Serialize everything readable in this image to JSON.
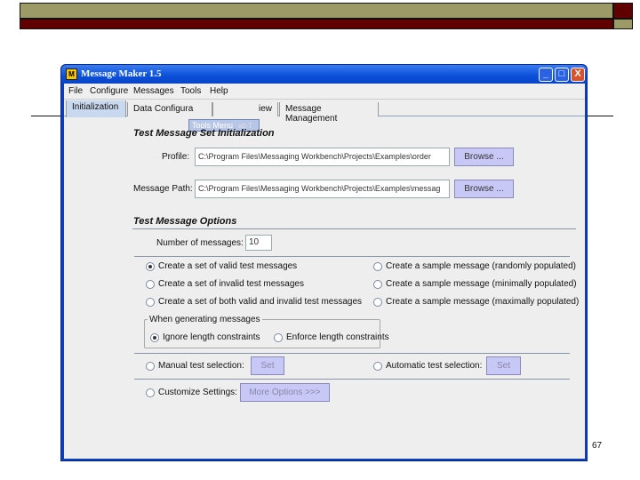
{
  "slide": {
    "page_number": "67",
    "colors": {
      "olive": "#9c9a66",
      "maroon": "#600000"
    }
  },
  "window": {
    "title": "Message Maker 1.5",
    "icon": "app-icon",
    "icon_text": "M",
    "controls": {
      "minimize": "_",
      "maximize": "□",
      "close": "X"
    }
  },
  "menu": [
    "File",
    "Configure",
    "Messages",
    "Tools",
    "Help"
  ],
  "tabs": [
    "Initialization",
    "Data Configura",
    "iew",
    "Message Management"
  ],
  "tooltip": {
    "text": "Tools Menu",
    "accelerator": "alt-T"
  },
  "init": {
    "title": "Test Message Set Initialization",
    "profile_label": "Profile:",
    "profile_value": "C:\\Program Files\\Messaging Workbench\\Projects\\Examples\\order",
    "path_label": "Message Path:",
    "path_value": "C:\\Program Files\\Messaging Workbench\\Projects\\Examples\\messag",
    "browse": "Browse ..."
  },
  "options": {
    "title": "Test Message Options",
    "count_label": "Number of messages:",
    "count_value": "10",
    "left": [
      {
        "label": "Create a set of valid test messages",
        "selected": true
      },
      {
        "label": "Create a set of invalid test messages",
        "selected": false
      },
      {
        "label": "Create a set of both valid and invalid test messages",
        "selected": false
      }
    ],
    "right": [
      {
        "label": "Create a sample message (randomly populated)",
        "selected": false
      },
      {
        "label": "Create a sample message (minimally populated)",
        "selected": false
      },
      {
        "label": "Create a sample message (maximally populated)",
        "selected": false
      }
    ],
    "group_title": "When generating messages",
    "ignore": "Ignore length constraints",
    "enforce": "Enforce length constraints",
    "manual": "Manual test selection:",
    "automatic": "Automatic test selection:",
    "set": "Set",
    "customize": "Customize Settings:",
    "more": "More Options >>>"
  }
}
